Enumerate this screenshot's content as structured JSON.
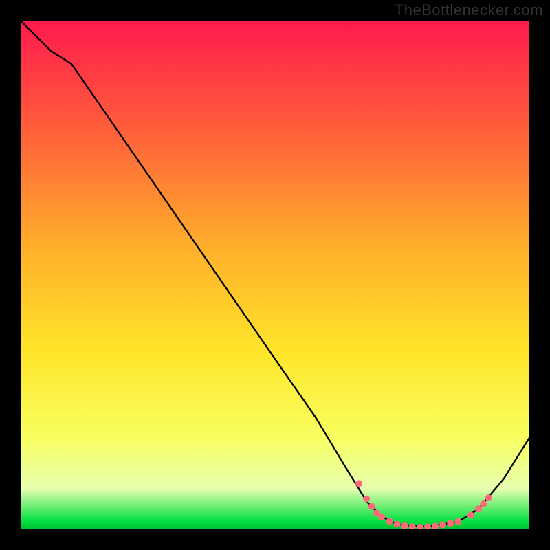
{
  "watermark": "TheBottlenecker.com",
  "chart_data": {
    "type": "line",
    "title": "",
    "xlabel": "",
    "ylabel": "",
    "xlim": [
      0,
      100
    ],
    "ylim": [
      0,
      100
    ],
    "gradient_stops": [
      {
        "offset": 0.0,
        "color": "#ff1a4d"
      },
      {
        "offset": 0.2,
        "color": "#ff5a3c"
      },
      {
        "offset": 0.45,
        "color": "#ffb02a"
      },
      {
        "offset": 0.65,
        "color": "#ffe52a"
      },
      {
        "offset": 0.82,
        "color": "#f8ff60"
      },
      {
        "offset": 0.92,
        "color": "#e8ffb0"
      },
      {
        "offset": 0.985,
        "color": "#00e040"
      },
      {
        "offset": 1.0,
        "color": "#00c030"
      }
    ],
    "curve": [
      {
        "x": 0.0,
        "y": 100.0
      },
      {
        "x": 6.0,
        "y": 94.0
      },
      {
        "x": 10.0,
        "y": 91.5
      },
      {
        "x": 20.0,
        "y": 77.0
      },
      {
        "x": 30.0,
        "y": 62.5
      },
      {
        "x": 40.0,
        "y": 48.0
      },
      {
        "x": 50.0,
        "y": 33.5
      },
      {
        "x": 58.0,
        "y": 22.0
      },
      {
        "x": 64.0,
        "y": 12.0
      },
      {
        "x": 68.0,
        "y": 5.5
      },
      {
        "x": 71.0,
        "y": 2.5
      },
      {
        "x": 74.0,
        "y": 1.0
      },
      {
        "x": 80.0,
        "y": 0.5
      },
      {
        "x": 86.0,
        "y": 1.5
      },
      {
        "x": 90.0,
        "y": 4.0
      },
      {
        "x": 95.0,
        "y": 10.0
      },
      {
        "x": 100.0,
        "y": 18.0
      }
    ],
    "markers": [
      {
        "x": 66.5,
        "y": 9.0
      },
      {
        "x": 68.0,
        "y": 6.0
      },
      {
        "x": 69.0,
        "y": 4.5
      },
      {
        "x": 70.0,
        "y": 3.2
      },
      {
        "x": 71.0,
        "y": 2.5
      },
      {
        "x": 72.5,
        "y": 1.6
      },
      {
        "x": 74.0,
        "y": 1.0
      },
      {
        "x": 75.5,
        "y": 0.7
      },
      {
        "x": 77.0,
        "y": 0.5
      },
      {
        "x": 78.5,
        "y": 0.4
      },
      {
        "x": 80.0,
        "y": 0.5
      },
      {
        "x": 81.5,
        "y": 0.6
      },
      {
        "x": 83.0,
        "y": 0.9
      },
      {
        "x": 84.5,
        "y": 1.2
      },
      {
        "x": 86.0,
        "y": 1.5
      },
      {
        "x": 88.5,
        "y": 2.8
      },
      {
        "x": 90.0,
        "y": 4.0
      },
      {
        "x": 91.0,
        "y": 5.0
      },
      {
        "x": 92.0,
        "y": 6.2
      }
    ],
    "curve_color": "#000000",
    "curve_width": 2.4,
    "marker_color": "#ff6a78",
    "marker_radius": 5
  }
}
